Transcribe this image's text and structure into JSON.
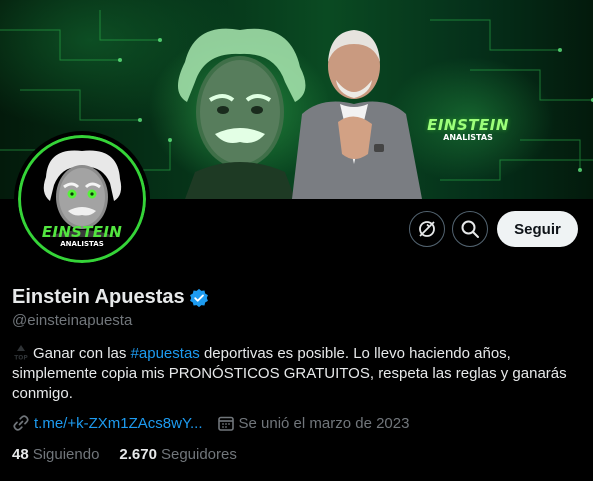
{
  "banner": {
    "logo_main": "EINSTEIN",
    "logo_sub": "ANALISTAS"
  },
  "avatar": {
    "logo_main": "EINSTEIN",
    "logo_sub": "ANALISTAS",
    "ring_color": "#35d438"
  },
  "actions": {
    "grok_icon": "grok-icon",
    "search_icon": "search-icon",
    "follow_label": "Seguir"
  },
  "profile": {
    "display_name": "Einstein Apuestas",
    "verified_icon": "verified-badge-icon",
    "handle": "@einsteinapuesta"
  },
  "bio": {
    "lead_icon": "top-icon",
    "part1": "Ganar con las ",
    "hashtag": "#apuestas",
    "part2": " deportivas es posible. Lo llevo haciendo años, simplemente copia mis PRONÓSTICOS GRATUITOS, respeta las reglas y ganarás conmigo."
  },
  "meta": {
    "link_icon": "link-icon",
    "link_text": "t.me/+k-ZXm1ZAcs8wY...",
    "calendar_icon": "calendar-icon",
    "joined_text": "Se unió el marzo de 2023"
  },
  "stats": {
    "following_count": "48",
    "following_label": "Siguiendo",
    "followers_count": "2.670",
    "followers_label": "Seguidores"
  },
  "colors": {
    "accent": "#1d9bf0",
    "follow_bg": "#eff3f4",
    "muted": "#71767b",
    "brand_green": "#35d438"
  }
}
